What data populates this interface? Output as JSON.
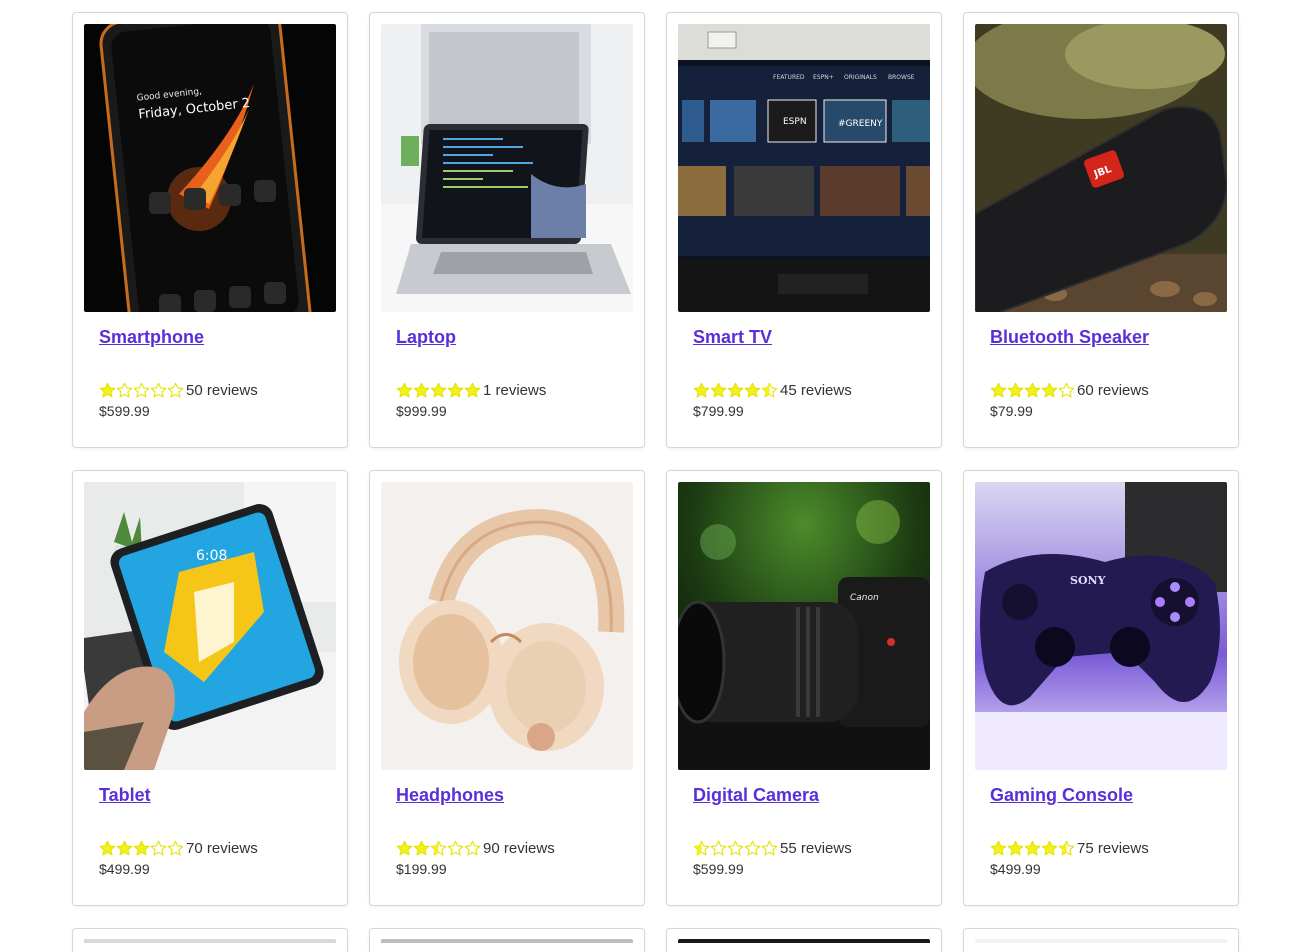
{
  "products": [
    {
      "name": "Smartphone",
      "rating": 1,
      "reviews_label": "50 reviews",
      "price": "$599.99",
      "image": "smartphone"
    },
    {
      "name": "Laptop",
      "rating": 5,
      "reviews_label": "1 reviews",
      "price": "$999.99",
      "image": "laptop"
    },
    {
      "name": "Smart TV",
      "rating": 4.5,
      "reviews_label": "45 reviews",
      "price": "$799.99",
      "image": "smart-tv"
    },
    {
      "name": "Bluetooth Speaker",
      "rating": 4,
      "reviews_label": "60 reviews",
      "price": "$79.99",
      "image": "bluetooth-speaker"
    },
    {
      "name": "Tablet",
      "rating": 3,
      "reviews_label": "70 reviews",
      "price": "$499.99",
      "image": "tablet"
    },
    {
      "name": "Headphones",
      "rating": 2.5,
      "reviews_label": "90 reviews",
      "price": "$199.99",
      "image": "headphones"
    },
    {
      "name": "Digital Camera",
      "rating": 0.5,
      "reviews_label": "55 reviews",
      "price": "$599.99",
      "image": "digital-camera"
    },
    {
      "name": "Gaming Console",
      "rating": 4.5,
      "reviews_label": "75 reviews",
      "price": "$499.99",
      "image": "gaming-console"
    }
  ],
  "colors": {
    "title_link": "#5b2fd6",
    "star_fill": "#f2f21a",
    "star_outline": "#e3e300",
    "card_border": "#d6d6d6"
  }
}
